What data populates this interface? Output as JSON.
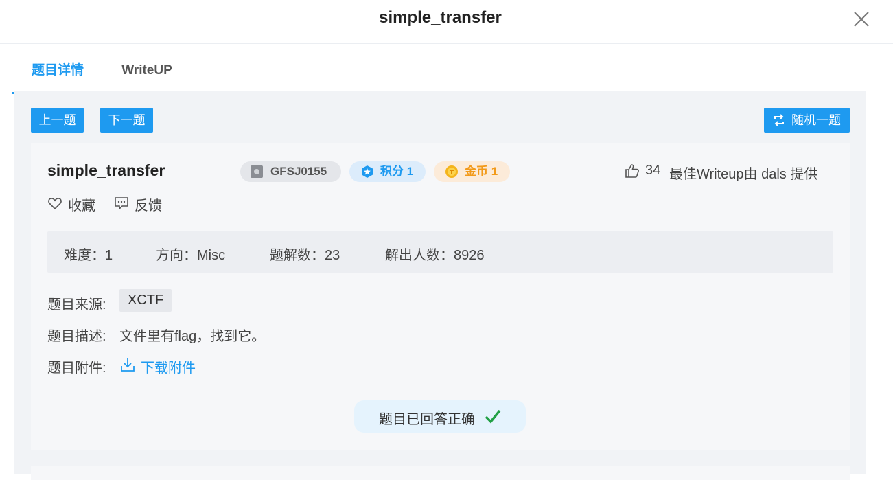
{
  "dialog": {
    "title": "simple_transfer"
  },
  "tabs": [
    {
      "label": "题目详情"
    },
    {
      "label": "WriteUP"
    }
  ],
  "nav": {
    "prev": "上一题",
    "next": "下一题",
    "random": "随机一题"
  },
  "problem": {
    "title": "simple_transfer",
    "code": "GFSJ0155",
    "score": "积分 1",
    "coins": "金币 1",
    "likes": "34",
    "best_writeup": "最佳Writeup由 dals 提供",
    "favorite": "收藏",
    "feedback": "反馈"
  },
  "stats": {
    "difficulty": "难度：1",
    "direction": "方向：Misc",
    "writeup_count": "题解数：23",
    "solvers": "解出人数：8926"
  },
  "info": {
    "source_label": "题目来源:",
    "source_value": "XCTF",
    "desc_label": "题目描述:",
    "desc_value": "文件里有flag，找到它。",
    "attach_label": "题目附件:",
    "attach_link": "下载附件"
  },
  "status": {
    "answered": "题目已回答正确"
  },
  "colors": {
    "accent": "#1e9af0",
    "success": "#22a045",
    "coin": "#f29a1a"
  },
  "icons": [
    "close-icon",
    "random-icon",
    "badge-icon",
    "star-icon",
    "coin-icon",
    "thumbs-up-icon",
    "heart-icon",
    "feedback-icon",
    "download-icon",
    "check-icon"
  ]
}
